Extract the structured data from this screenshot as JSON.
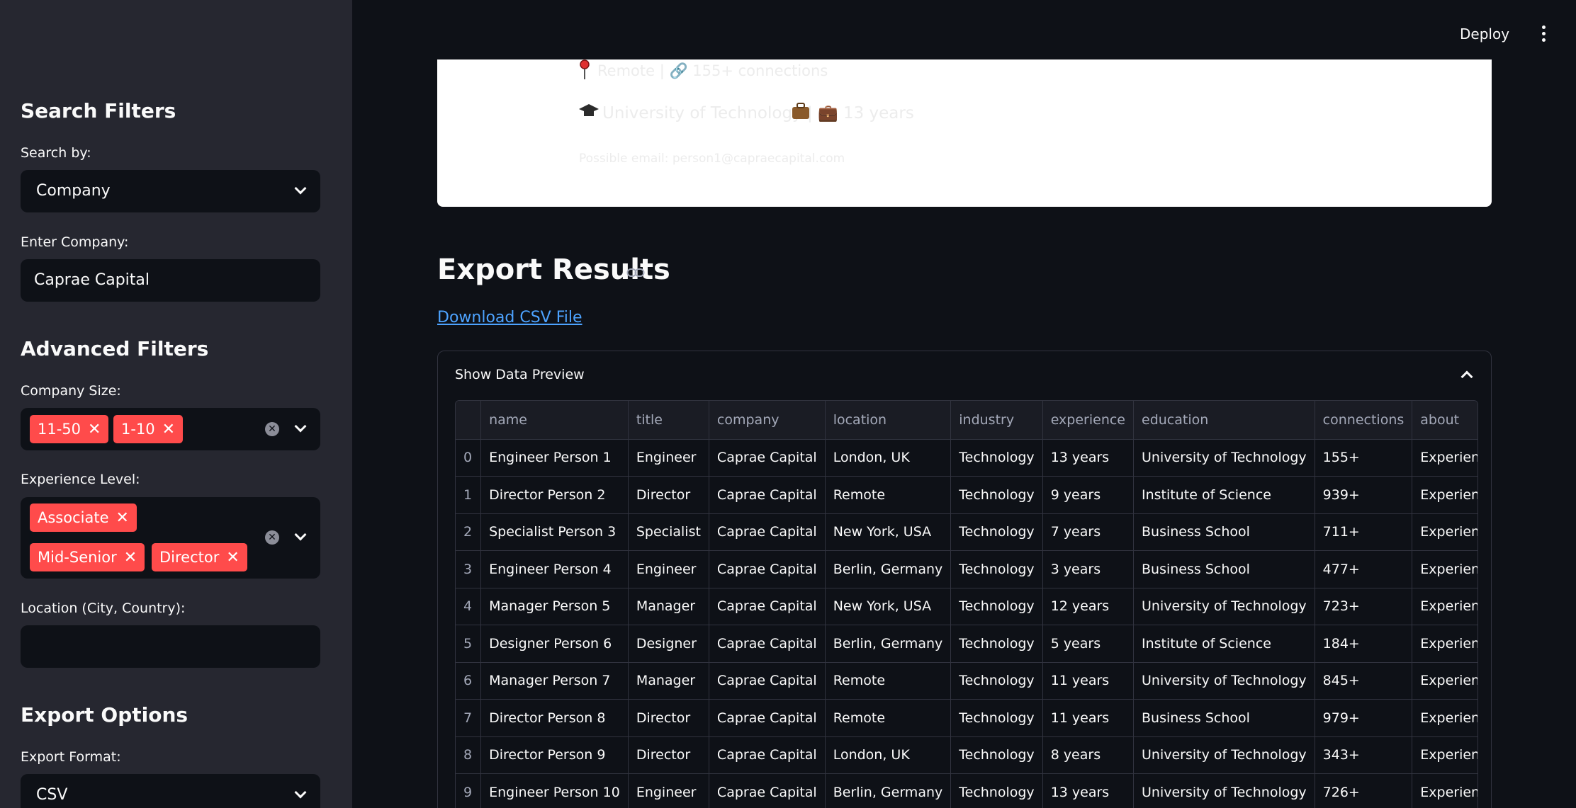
{
  "sidebar": {
    "search_filters_title": "Search Filters",
    "search_by_label": "Search by:",
    "search_by_value": "Company",
    "enter_company_label": "Enter Company:",
    "enter_company_value": "Caprae Capital",
    "advanced_filters_title": "Advanced Filters",
    "company_size_label": "Company Size:",
    "company_size_tags": [
      "11-50",
      "1-10"
    ],
    "experience_level_label": "Experience Level:",
    "experience_level_tags": [
      "Associate",
      "Mid-Senior",
      "Director"
    ],
    "location_label": "Location (City, Country):",
    "location_value": "",
    "export_options_title": "Export Options",
    "export_format_label": "Export Format:",
    "export_format_value": "CSV"
  },
  "topbar": {
    "deploy_label": "Deploy"
  },
  "card": {
    "line1": "Remote | 🔗 155+ connections",
    "line2": "University of Technology | 💼 13 years",
    "line3": "Possible email: person1@capraecapital.com"
  },
  "export": {
    "title": "Export Results",
    "download_link": "Download CSV File",
    "preview_title": "Show Data Preview"
  },
  "table": {
    "columns": [
      "",
      "name",
      "title",
      "company",
      "location",
      "industry",
      "experience",
      "education",
      "connections",
      "about"
    ],
    "rows": [
      [
        "0",
        "Engineer Person 1",
        "Engineer",
        "Caprae Capital",
        "London, UK",
        "Technology",
        "13 years",
        "University of Technology",
        "155+",
        "Experienced"
      ],
      [
        "1",
        "Director Person 2",
        "Director",
        "Caprae Capital",
        "Remote",
        "Technology",
        "9 years",
        "Institute of Science",
        "939+",
        "Experienced"
      ],
      [
        "2",
        "Specialist Person 3",
        "Specialist",
        "Caprae Capital",
        "New York, USA",
        "Technology",
        "7 years",
        "Business School",
        "711+",
        "Experienced"
      ],
      [
        "3",
        "Engineer Person 4",
        "Engineer",
        "Caprae Capital",
        "Berlin, Germany",
        "Technology",
        "3 years",
        "Business School",
        "477+",
        "Experienced"
      ],
      [
        "4",
        "Manager Person 5",
        "Manager",
        "Caprae Capital",
        "New York, USA",
        "Technology",
        "12 years",
        "University of Technology",
        "723+",
        "Experienced"
      ],
      [
        "5",
        "Designer Person 6",
        "Designer",
        "Caprae Capital",
        "Berlin, Germany",
        "Technology",
        "5 years",
        "Institute of Science",
        "184+",
        "Experienced"
      ],
      [
        "6",
        "Manager Person 7",
        "Manager",
        "Caprae Capital",
        "Remote",
        "Technology",
        "11 years",
        "University of Technology",
        "845+",
        "Experienced"
      ],
      [
        "7",
        "Director Person 8",
        "Director",
        "Caprae Capital",
        "Remote",
        "Technology",
        "11 years",
        "Business School",
        "979+",
        "Experienced"
      ],
      [
        "8",
        "Director Person 9",
        "Director",
        "Caprae Capital",
        "London, UK",
        "Technology",
        "8 years",
        "University of Technology",
        "343+",
        "Experienced"
      ],
      [
        "9",
        "Engineer Person 10",
        "Engineer",
        "Caprae Capital",
        "Berlin, Germany",
        "Technology",
        "13 years",
        "University of Technology",
        "726+",
        "Experienced"
      ]
    ]
  },
  "colors": {
    "accent": "#ff4b4b",
    "link": "#4da3ff",
    "sidebar_bg": "#262730",
    "main_bg": "#0e1117"
  }
}
